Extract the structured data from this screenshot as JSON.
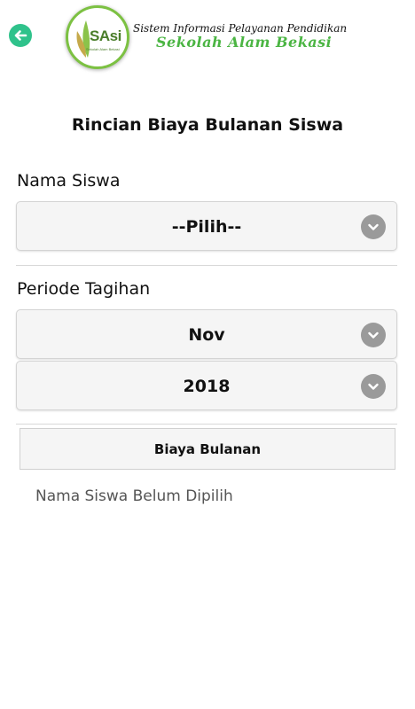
{
  "header": {
    "back_icon": "arrow-left-icon",
    "logo_text": "SAsi",
    "logo_subtext": "Sekolah Alam Bekasi",
    "app_title_line1": "Sistem Informasi Pelayanan Pendidikan",
    "app_title_line2": "Sekolah Alam Bekasi",
    "accent_color": "#2fc28b"
  },
  "page_title": "Rincian Biaya Bulanan Siswa",
  "student": {
    "label": "Nama Siswa",
    "selected": "--Pilih--"
  },
  "period": {
    "label": "Periode Tagihan",
    "month": "Nov",
    "year": "2018"
  },
  "action": {
    "button_label": "Biaya Bulanan"
  },
  "status_text": "Nama Siswa Belum Dipilih"
}
